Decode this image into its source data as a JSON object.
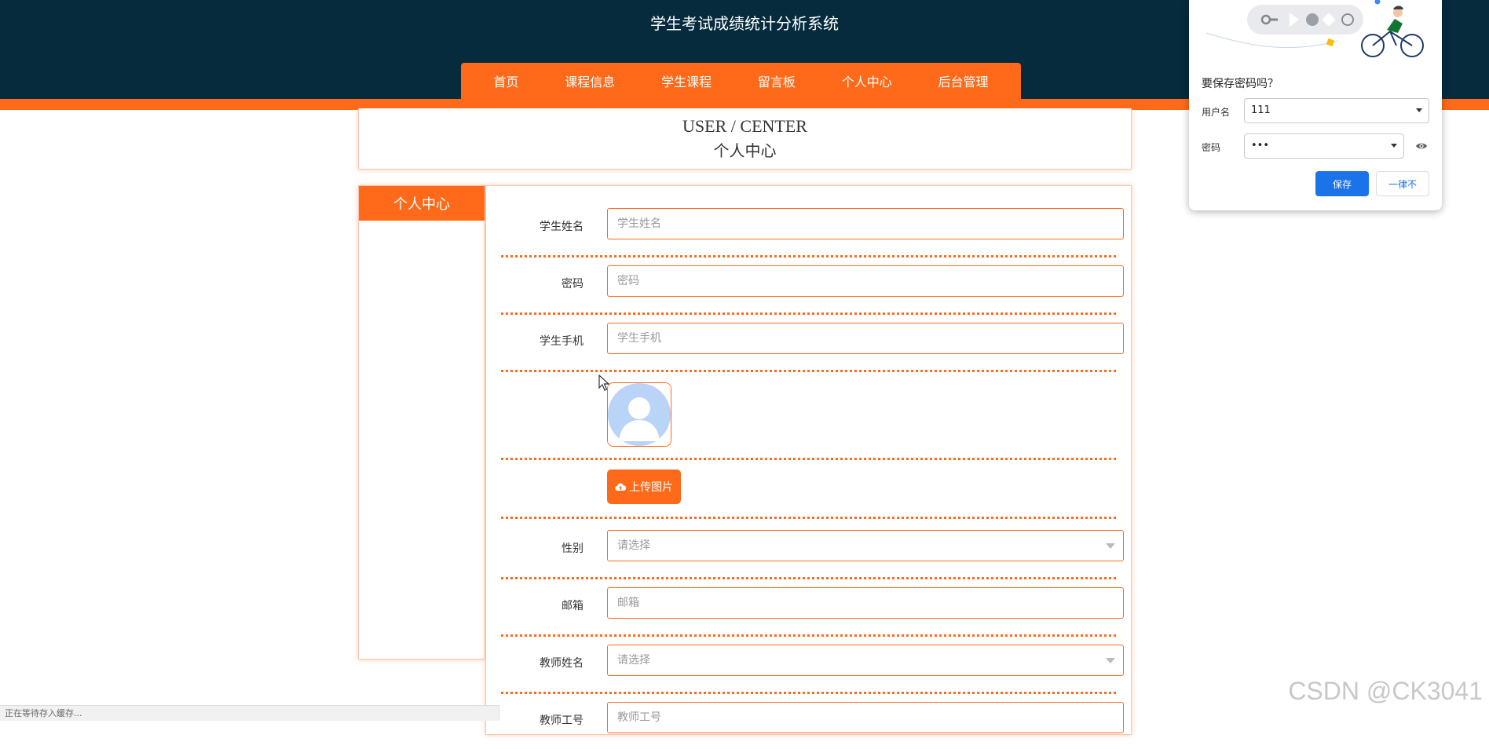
{
  "header": {
    "title": "学生考试成绩统计分析系统"
  },
  "nav": {
    "items": [
      {
        "label": "首页"
      },
      {
        "label": "课程信息"
      },
      {
        "label": "学生课程"
      },
      {
        "label": "留言板"
      },
      {
        "label": "个人中心"
      },
      {
        "label": "后台管理"
      }
    ]
  },
  "banner": {
    "en": "USER / CENTER",
    "cn": "个人中心"
  },
  "sidebar": {
    "title": "个人中心"
  },
  "form": {
    "fields": [
      {
        "label": "学生姓名",
        "placeholder": "学生姓名"
      },
      {
        "label": "密码",
        "placeholder": "密码"
      },
      {
        "label": "学生手机",
        "placeholder": "学生手机"
      },
      {
        "label": "性别",
        "placeholder": "请选择"
      },
      {
        "label": "邮箱",
        "placeholder": "邮箱"
      },
      {
        "label": "教师姓名",
        "placeholder": "请选择"
      },
      {
        "label": "教师工号",
        "placeholder": "教师工号"
      }
    ],
    "upload_label": "上传图片"
  },
  "password_dialog": {
    "title": "要保存密码吗？",
    "username_label": "用户名",
    "username_value": "111",
    "password_label": "密码",
    "password_value": "•••",
    "save_label": "保存",
    "never_label": "一律不"
  },
  "status_bar": {
    "text": "正在等待存入缓存..."
  },
  "watermark": {
    "text": "CSDN @CK3041"
  },
  "colors": {
    "accent": "#ff6a1a",
    "header": "#052b3d",
    "primary_blue": "#1a73e8"
  }
}
